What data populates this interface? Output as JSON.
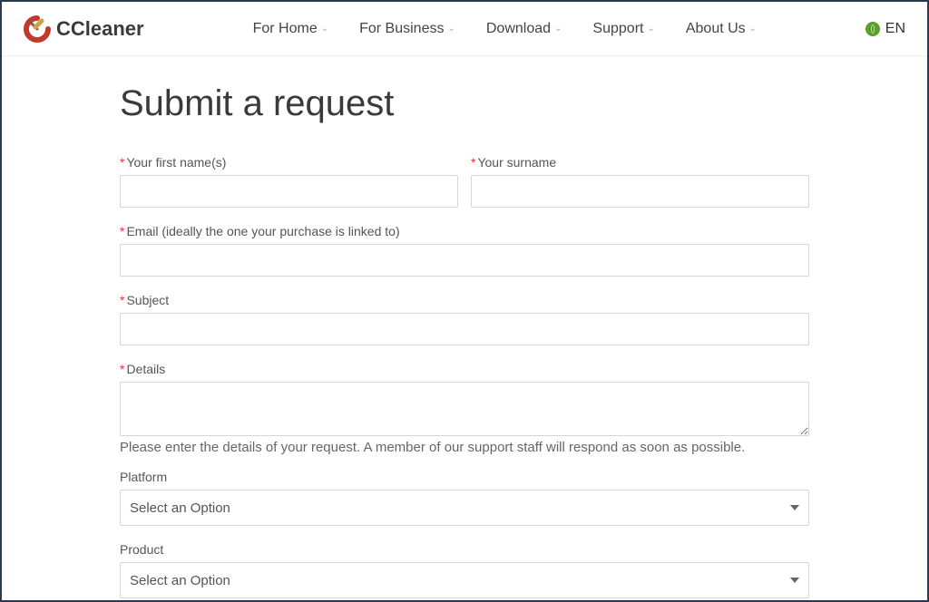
{
  "brand": "CCleaner",
  "nav": {
    "home": "For Home",
    "business": "For Business",
    "download": "Download",
    "support": "Support",
    "about": "About Us"
  },
  "lang": "EN",
  "page": {
    "title": "Submit a request"
  },
  "form": {
    "first_name_label": "Your first name(s)",
    "surname_label": "Your surname",
    "email_label": "Email (ideally the one your purchase is linked to)",
    "subject_label": "Subject",
    "details_label": "Details",
    "details_hint": "Please enter the details of your request. A member of our support staff will respond as soon as possible.",
    "platform_label": "Platform",
    "platform_value": "Select an Option",
    "product_label": "Product",
    "product_value": "Select an Option"
  }
}
